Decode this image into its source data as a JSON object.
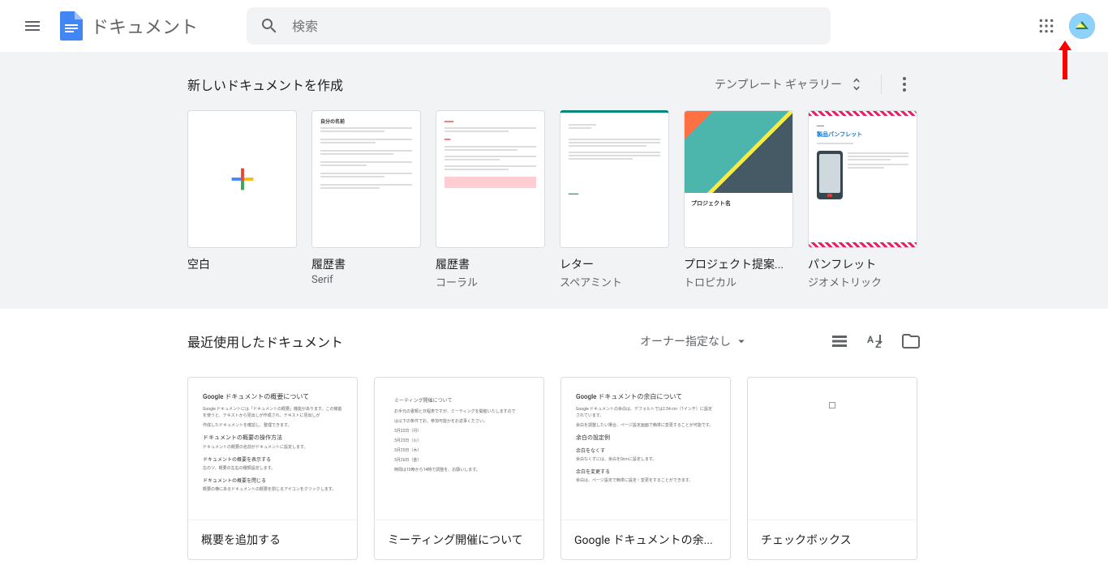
{
  "header": {
    "app_title": "ドキュメント",
    "search_placeholder": "検索"
  },
  "template_section": {
    "title": "新しいドキュメントを作成",
    "gallery_label": "テンプレート ギャラリー",
    "templates": [
      {
        "name": "空白",
        "sub": ""
      },
      {
        "name": "履歴書",
        "sub": "Serif"
      },
      {
        "name": "履歴書",
        "sub": "コーラル"
      },
      {
        "name": "レター",
        "sub": "スペアミント"
      },
      {
        "name": "プロジェクト提案...",
        "sub": "トロピカル"
      },
      {
        "name": "パンフレット",
        "sub": "ジオメトリック"
      }
    ],
    "thumb_resume_serif": {
      "heading": "自分の名前"
    },
    "thumb_tropical": {
      "heading": "プロジェクト名"
    },
    "thumb_geo": {
      "heading": "製品パンフレット"
    }
  },
  "recent_section": {
    "title": "最近使用したドキュメント",
    "filter_label": "オーナー指定なし",
    "docs": [
      {
        "name": "概要を追加する",
        "thumb_title": "Google ドキュメントの概要について"
      },
      {
        "name": "ミーティング開催について",
        "thumb_title": "ミーティング開催について"
      },
      {
        "name": "Google ドキュメントの余...",
        "thumb_title": "Google ドキュメントの余白について"
      },
      {
        "name": "チェックボックス",
        "thumb_title": ""
      }
    ],
    "thumb0": {
      "t1": "Google ドキュメントには「ドキュメントの概要」機能があります。この機能を使うと、テキストから見出しが作成され、テキストに見出しが",
      "t2": "作成したドキュメントを確認し、整理できます。",
      "h1": "ドキュメントの概要の操作方法",
      "t3": "ドキュメントの概要の名前がドキュメントに設定します。",
      "h2": "ドキュメントの概要を表示する",
      "t4": "左のツ、概要の左右の種類設定します。",
      "h3": "ドキュメントの概要を閉じる",
      "t5": "概要の横にあるドキュメントの概要を閉じるアイコンをクリックします。"
    },
    "thumb1": {
      "t1": "お手元の書類と日程表ですが、ミーティングを開催いたしますので",
      "t2": "は以下の条件でお、参加可能かをお返事ください。",
      "d1": "3月22日（月）",
      "d2": "3月23日（火）",
      "d3": "3月25日（木）",
      "d4": "3月26日（金）",
      "t3": "時間は10時から14時で調整を、お願いします。"
    },
    "thumb2": {
      "t1": "Google ドキュメントの余白は、デフォルトでは2.54 cm（1インチ）に設定されています。",
      "t2": "余白を調整したい場合、ページ設定画面で簡単に変更することが可能です。",
      "h1": "余白の設定例",
      "h2": "余白をなくす",
      "t3": "余白なくすには、余白を0cmに設定します。",
      "h3": "余白を変更する",
      "t4": "余白は、ページ設定で簡単に設定・変更をすることができます。"
    }
  }
}
